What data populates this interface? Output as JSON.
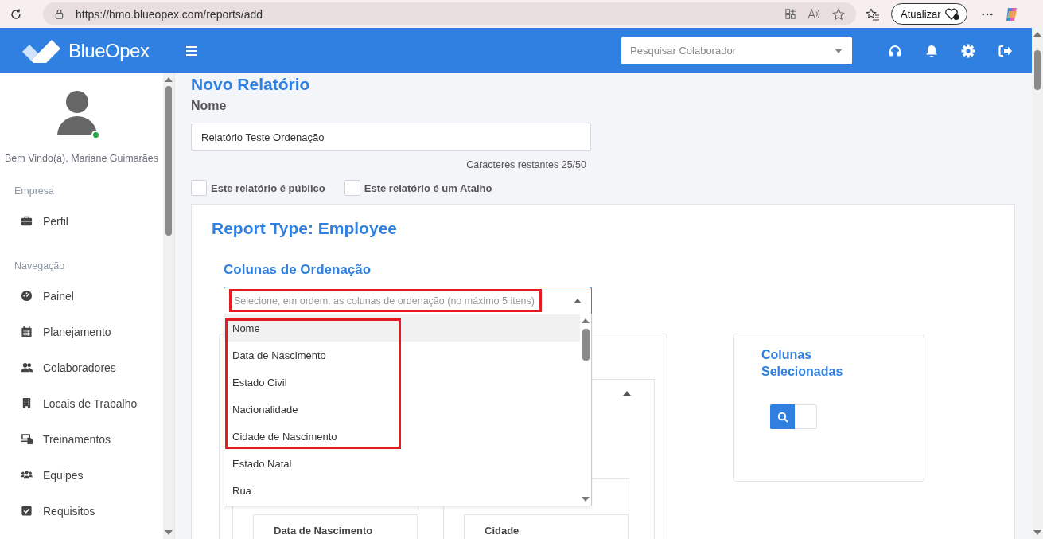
{
  "browser": {
    "url": "https://hmo.blueopex.com/reports/add",
    "update_button": "Atualizar"
  },
  "header": {
    "logo": "BlueOpex",
    "search": {
      "placeholder": "Pesquisar Colaborador"
    }
  },
  "sidebar": {
    "welcome": "Bem Vindo(a), Mariane Guimarães",
    "online": true,
    "sections": [
      {
        "title": "Empresa",
        "items": [
          {
            "label": "Perfil"
          }
        ]
      },
      {
        "title": "Navegação",
        "items": [
          {
            "label": "Painel"
          },
          {
            "label": "Planejamento"
          },
          {
            "label": "Colaboradores"
          },
          {
            "label": "Locais de Trabalho"
          },
          {
            "label": "Treinamentos"
          },
          {
            "label": "Equipes"
          },
          {
            "label": "Requisitos"
          }
        ]
      }
    ]
  },
  "page": {
    "title": "Novo Relatório",
    "name_label": "Nome",
    "name_value": "Relatório Teste Ordenação",
    "counter": "Caracteres restantes 25/50",
    "checkboxes": [
      {
        "label": "Este relatório é público",
        "checked": false
      },
      {
        "label": "Este relatório é um Atalho",
        "checked": false
      }
    ]
  },
  "report": {
    "title": "Report Type: Employee",
    "sort_label": "Colunas de Ordenação",
    "sort_select": {
      "placeholder": "Selecione, em ordem, as colunas de ordenação (no máximo 5 itens)",
      "expanded": true,
      "annotated": true
    },
    "options": [
      {
        "label": "Nome",
        "selected": true,
        "annotated": true
      },
      {
        "label": "Data de Nascimento",
        "selected": false,
        "annotated": true
      },
      {
        "label": "Estado Civil",
        "selected": false,
        "annotated": true
      },
      {
        "label": "Nacionalidade",
        "selected": false,
        "annotated": true
      },
      {
        "label": "Cidade de Nascimento",
        "selected": false,
        "annotated": true
      },
      {
        "label": "Estado Natal",
        "selected": false,
        "annotated": false
      },
      {
        "label": "Rua",
        "selected": false,
        "annotated": false
      }
    ],
    "available_columns": {
      "headers": [
        "Data de Nascimento",
        "Cidade"
      ]
    },
    "selected_columns": {
      "title": "Colunas Selecionadas"
    }
  }
}
